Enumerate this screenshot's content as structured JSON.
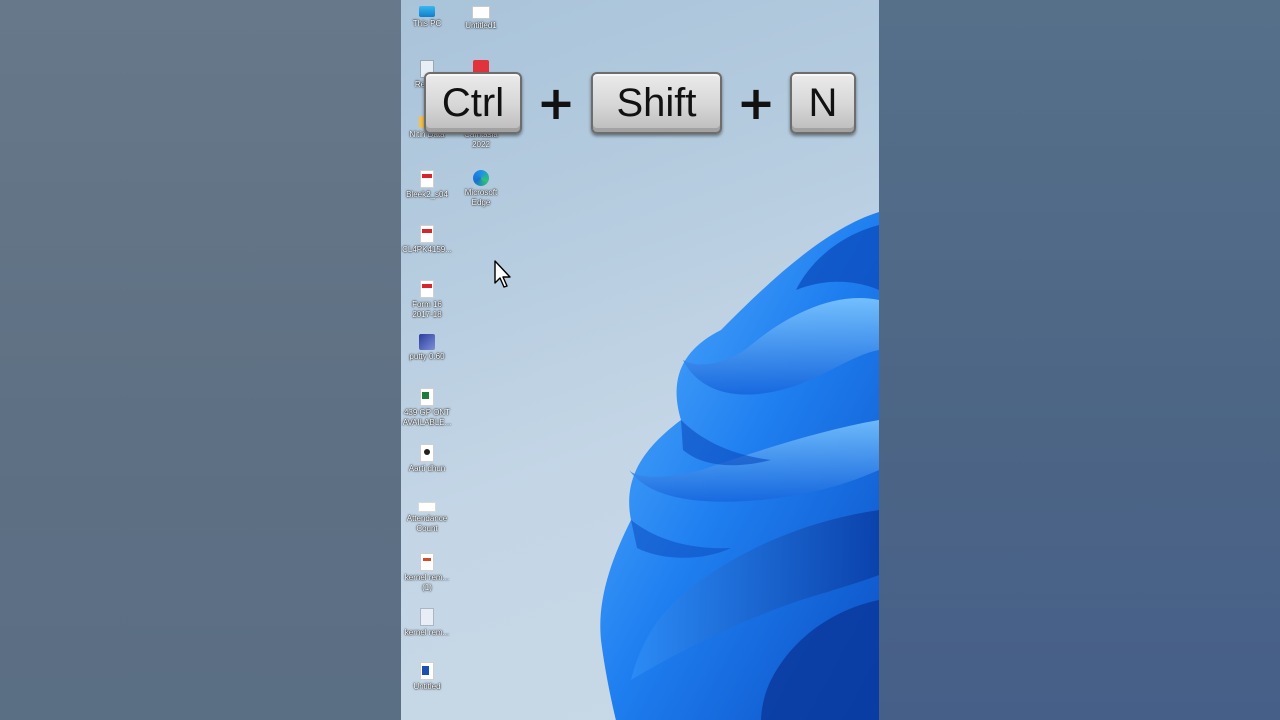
{
  "shortcut": {
    "keys": [
      "Ctrl",
      "Shift",
      "N"
    ],
    "separator": "+"
  },
  "desktop_icons": [
    {
      "label": "This PC",
      "icon": "computer-icon"
    },
    {
      "label": "Untitled1",
      "icon": "blank-file-icon"
    },
    {
      "label": "Recy...",
      "icon": "recycle-bin-icon"
    },
    {
      "label": "",
      "icon": "red-app-icon"
    },
    {
      "label": "Nitin Data",
      "icon": "folder-icon"
    },
    {
      "label": "Camtasia\n2022",
      "icon": "camtasia-icon"
    },
    {
      "label": "Bleek2_s04",
      "icon": "pdf-icon"
    },
    {
      "label": "Microsoft\nEdge",
      "icon": "edge-icon"
    },
    {
      "label": "CL4PK4159...",
      "icon": "pdf-icon"
    },
    {
      "label": "Form 16\n2017-18",
      "icon": "pdf-icon"
    },
    {
      "label": "putty 0.60",
      "icon": "putty-icon"
    },
    {
      "label": "439 GP ONT\nAVAILABLE...",
      "icon": "excel-icon"
    },
    {
      "label": "Aarti dhun",
      "icon": "media-file-icon"
    },
    {
      "label": "Attendance\nCount",
      "icon": "white-file-icon"
    },
    {
      "label": "kernel rem...\n(1)",
      "icon": "kernel-file-icon"
    },
    {
      "label": "kernel rem...",
      "icon": "document-icon"
    },
    {
      "label": "Untitled",
      "icon": "word-file-icon"
    }
  ],
  "colors": {
    "wallpaper_bloom": "#1a6fe0",
    "wallpaper_bg": "#b7cde0",
    "key_face": "#d6d6d6",
    "key_border": "#6d6d6d"
  }
}
